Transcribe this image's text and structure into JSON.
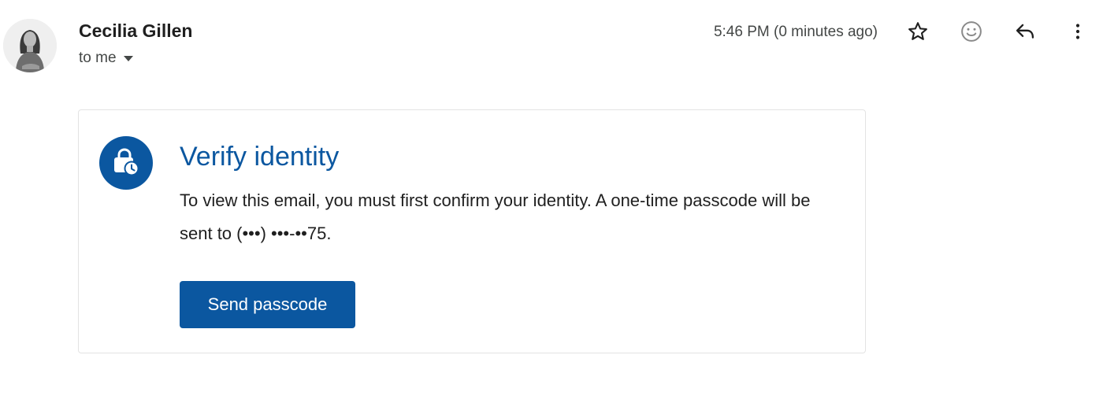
{
  "header": {
    "sender_name": "Cecilia Gillen",
    "recipient_label": "to me",
    "timestamp": "5:46 PM (0 minutes ago)",
    "actions": {
      "star": "star-icon",
      "emoji": "emoji-reaction-icon",
      "reply": "reply-icon",
      "more": "more-vert-icon"
    }
  },
  "card": {
    "badge_icon": "lock-clock-icon",
    "title": "Verify identity",
    "body": "To view this email, you must first confirm your identity. A one-time passcode will be sent to (•••) •••-••75.",
    "button_label": "Send passcode"
  },
  "colors": {
    "accent": "#0b57a0",
    "text_primary": "#1f1f1f",
    "text_secondary": "#444746",
    "card_border": "#e3e3e3"
  }
}
